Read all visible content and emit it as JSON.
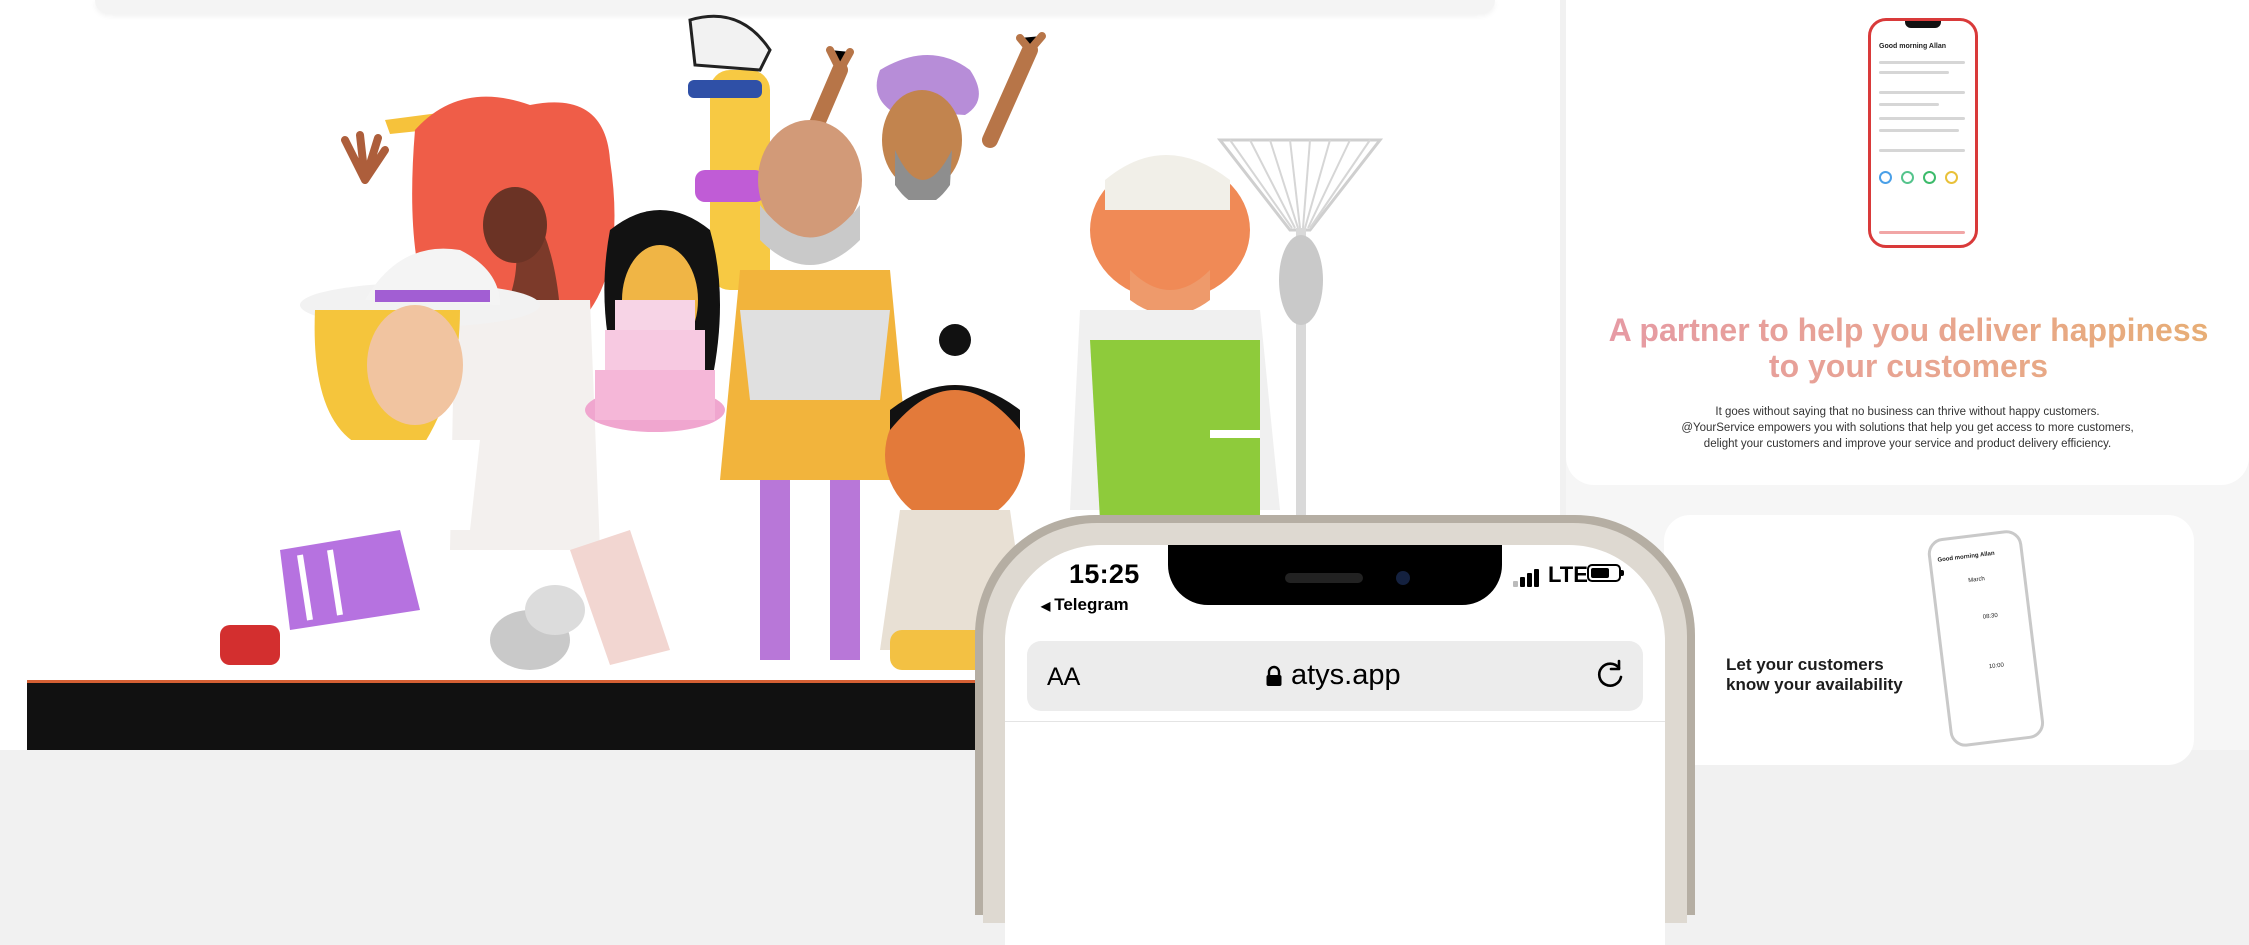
{
  "phone": {
    "time": "15:25",
    "back_label": "Telegram",
    "network": "LTE",
    "text_size_button": "AA",
    "url": "atys.app"
  },
  "right_column": {
    "mini_phone_greeting": "Good morning Allan",
    "partner_heading": "A partner to help you deliver happiness to your customers",
    "partner_desc_lines": [
      "It goes without saying that no business can thrive without happy customers.",
      "@YourService empowers you with solutions that help you get access to more customers,",
      "delight your customers and improve your service and product delivery efficiency."
    ],
    "availability_heading": "Let your customers know your availability",
    "availability_phone_greeting": "Good morning Allan",
    "availability_phone_month": "March",
    "availability_times": [
      "08:30",
      "10:00"
    ]
  },
  "colors": {
    "heading_gradient_start": "#e69aa5",
    "heading_gradient_end": "#e7ae74",
    "hero_band": "#111111",
    "hero_band_accent": "#d56034"
  },
  "icons": [
    "back-arrow-icon",
    "signal-icon",
    "battery-icon",
    "lock-icon",
    "reload-icon"
  ]
}
